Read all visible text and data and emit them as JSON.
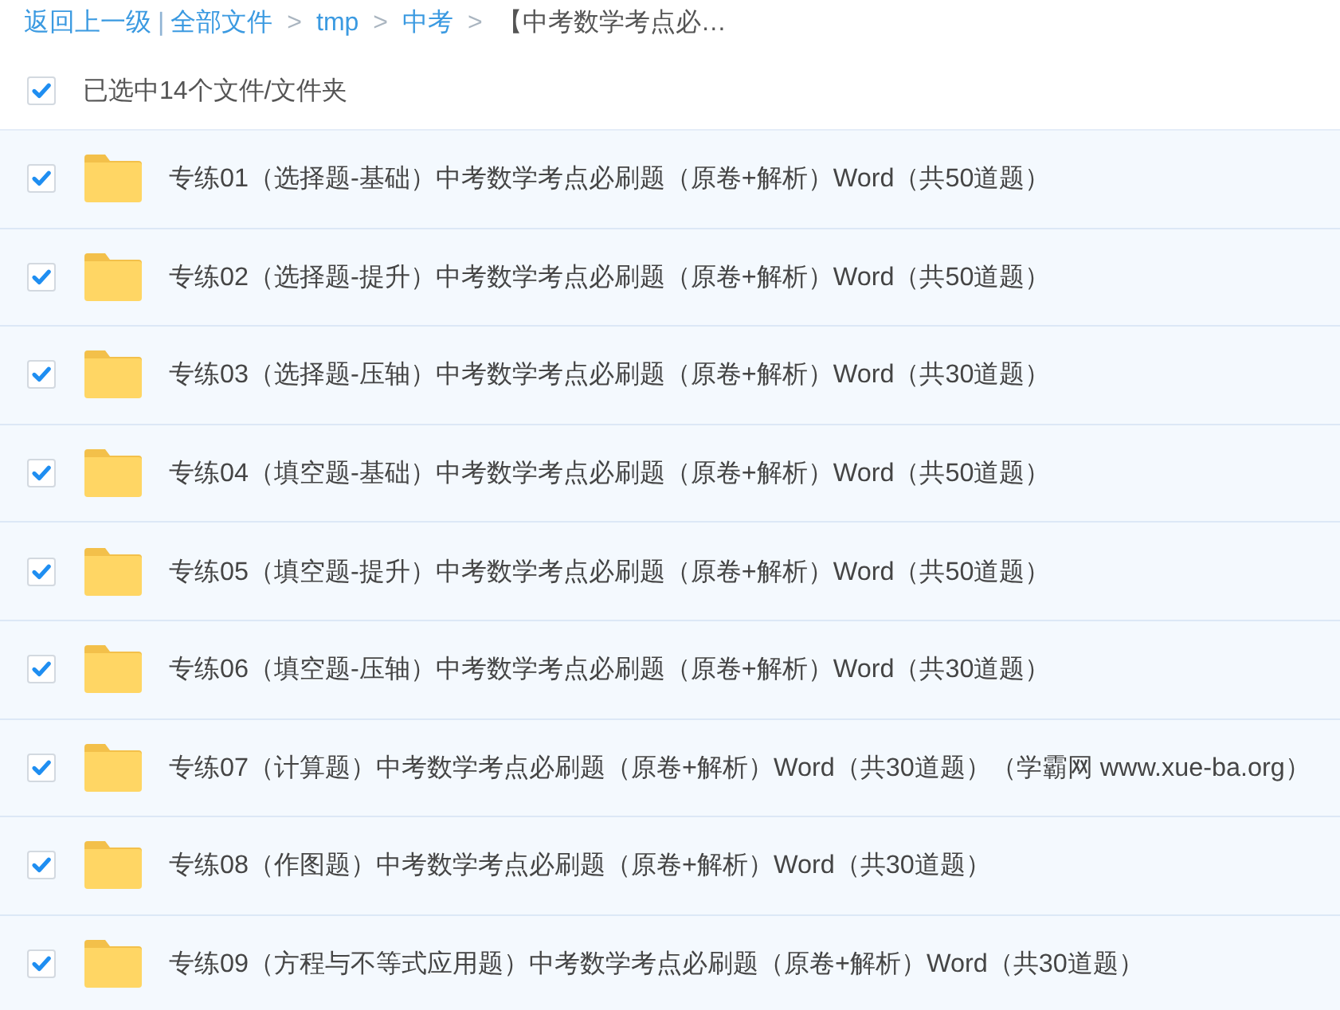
{
  "breadcrumb": {
    "back": "返回上一级",
    "divider": "|",
    "items": [
      {
        "label": "全部文件",
        "current": false
      },
      {
        "separator": ">",
        "label": "tmp",
        "current": false
      },
      {
        "separator": ">",
        "label": "中考",
        "current": false
      },
      {
        "separator": ">",
        "label": "【中考数学考点必…",
        "current": true
      }
    ]
  },
  "select_all": {
    "checked": true,
    "label": "已选中14个文件/文件夹"
  },
  "files": [
    {
      "name": "专练01（选择题-基础）中考数学考点必刷题（原卷+解析）Word（共50道题）",
      "checked": true
    },
    {
      "name": "专练02（选择题-提升）中考数学考点必刷题（原卷+解析）Word（共50道题）",
      "checked": true
    },
    {
      "name": "专练03（选择题-压轴）中考数学考点必刷题（原卷+解析）Word（共30道题）",
      "checked": true
    },
    {
      "name": "专练04（填空题-基础）中考数学考点必刷题（原卷+解析）Word（共50道题）",
      "checked": true
    },
    {
      "name": "专练05（填空题-提升）中考数学考点必刷题（原卷+解析）Word（共50道题）",
      "checked": true
    },
    {
      "name": "专练06（填空题-压轴）中考数学考点必刷题（原卷+解析）Word（共30道题）",
      "checked": true
    },
    {
      "name": "专练07（计算题）中考数学考点必刷题（原卷+解析）Word（共30道题）（学霸网 www.xue-ba.org）",
      "checked": true
    },
    {
      "name": "专练08（作图题）中考数学考点必刷题（原卷+解析）Word（共30道题）",
      "checked": true
    },
    {
      "name": "专练09（方程与不等式应用题）中考数学考点必刷题（原卷+解析）Word（共30道题）",
      "checked": true
    }
  ]
}
